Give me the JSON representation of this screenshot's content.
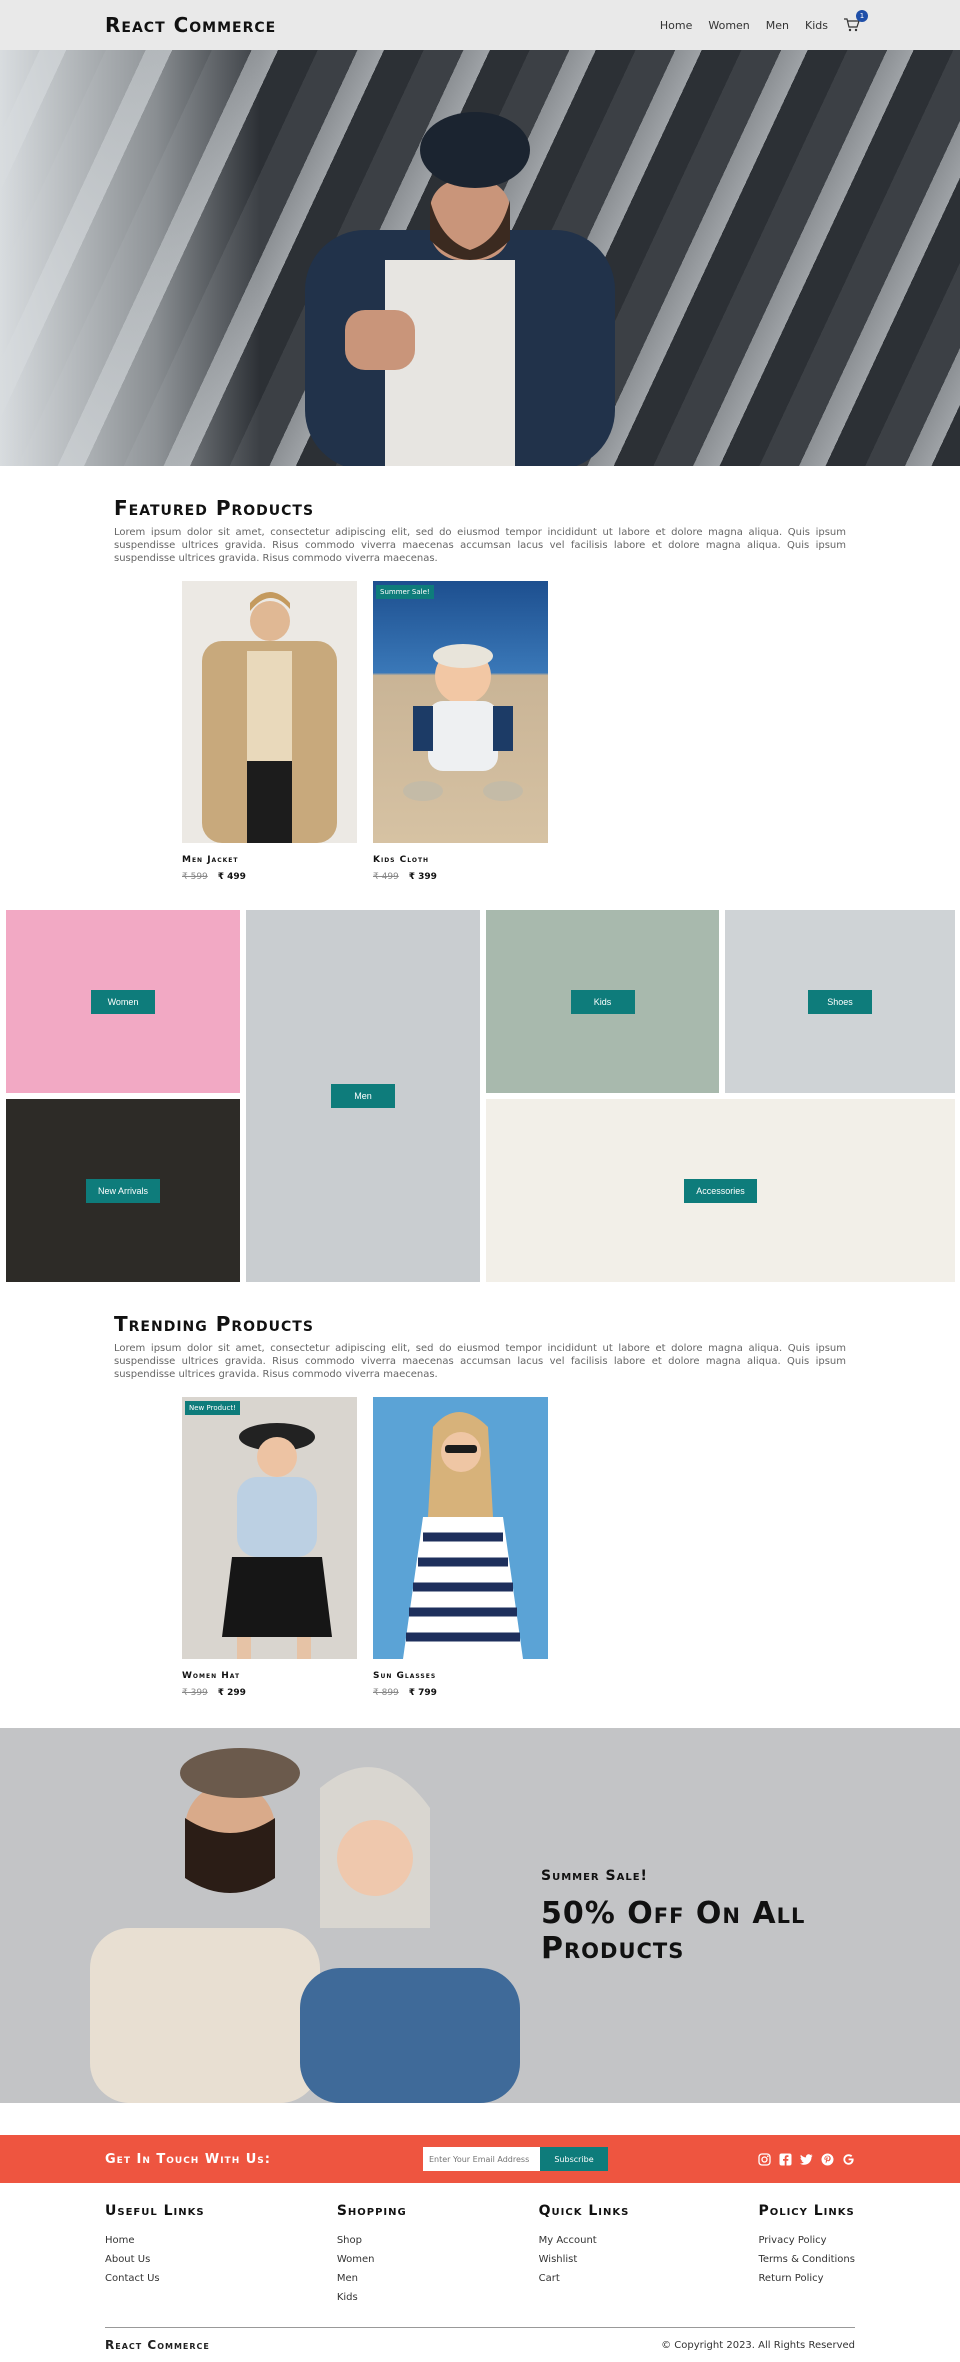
{
  "header": {
    "logo": "React Commerce",
    "nav": [
      "Home",
      "Women",
      "Men",
      "Kids"
    ],
    "cart_count": "1"
  },
  "featured": {
    "title": "Featured Products",
    "desc": "Lorem ipsum dolor sit amet, consectetur adipiscing elit, sed do eiusmod tempor incididunt ut labore et dolore magna aliqua. Quis ipsum suspendisse ultrices gravida. Risus commodo viverra maecenas accumsan lacus vel facilisis labore et dolore magna aliqua. Quis ipsum suspendisse ultrices gravida. Risus commodo viverra maecenas.",
    "products": [
      {
        "title": "Men Jacket",
        "old": "₹ 599",
        "new": "₹ 499",
        "badge": ""
      },
      {
        "title": "Kids Cloth",
        "old": "₹ 499",
        "new": "₹ 399",
        "badge": "Summer Sale!"
      }
    ]
  },
  "categories": {
    "women": "Women",
    "men": "Men",
    "kids": "Kids",
    "shoes": "Shoes",
    "new": "New Arrivals",
    "accessories": "Accessories"
  },
  "trending": {
    "title": "Trending Products",
    "desc": "Lorem ipsum dolor sit amet, consectetur adipiscing elit, sed do eiusmod tempor incididunt ut labore et dolore magna aliqua. Quis ipsum suspendisse ultrices gravida. Risus commodo viverra maecenas accumsan lacus vel facilisis labore et dolore magna aliqua. Quis ipsum suspendisse ultrices gravida. Risus commodo viverra maecenas.",
    "products": [
      {
        "title": "Women Hat",
        "old": "₹ 399",
        "new": "₹ 299",
        "badge": "New Product!"
      },
      {
        "title": "Sun Glasses",
        "old": "₹ 899",
        "new": "₹ 799",
        "badge": ""
      }
    ]
  },
  "summer": {
    "sub": "Summer Sale!",
    "headline": "50% Off On All Products"
  },
  "contact": {
    "title": "Get In Touch With Us:",
    "placeholder": "Enter Your Email Address",
    "button": "Subscribe",
    "socials": [
      "instagram-icon",
      "facebook-icon",
      "twitter-icon",
      "pinterest-icon",
      "google-icon"
    ]
  },
  "footer": {
    "useful": {
      "title": "Useful Links",
      "links": [
        "Home",
        "About Us",
        "Contact Us"
      ]
    },
    "shopping": {
      "title": "Shopping",
      "links": [
        "Shop",
        "Women",
        "Men",
        "Kids"
      ]
    },
    "quick": {
      "title": "Quick Links",
      "links": [
        "My Account",
        "Wishlist",
        "Cart"
      ]
    },
    "policy": {
      "title": "Policy Links",
      "links": [
        "Privacy Policy",
        "Terms & Conditions",
        "Return Policy"
      ]
    },
    "logo": "React Commerce",
    "copyright": "© Copyright 2023. All Rights Reserved"
  },
  "colors": {
    "accent": "#0e7c7b",
    "contact_bar": "#ee5540",
    "header_bg": "#e9e9e9",
    "badge": "#1f4fa8"
  }
}
